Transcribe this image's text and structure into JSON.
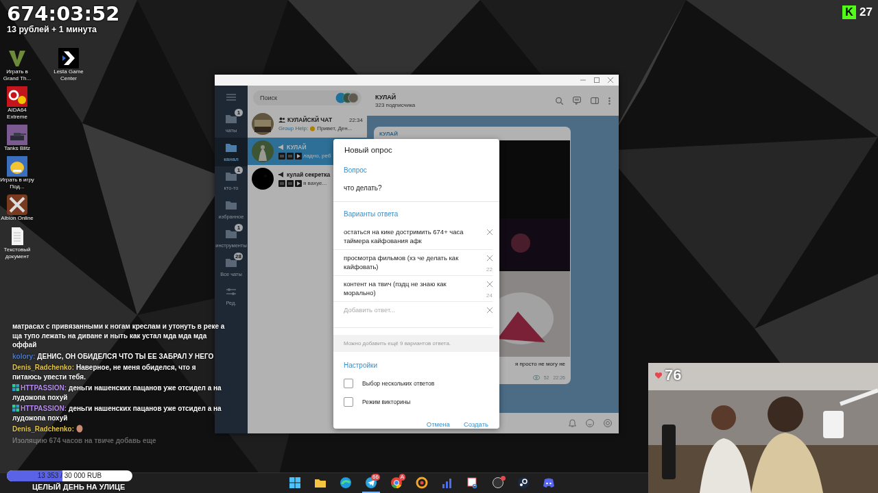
{
  "stream_overlay": {
    "timer": "674:03:52",
    "timer_note": "13 рублей + 1 минута",
    "viewer_badge": {
      "logo": "K",
      "count": "27"
    },
    "likes": "76",
    "goal": {
      "reading": "13 353 / 30 000 RUB",
      "level": 0.445,
      "title": "ЦЕЛЫЙ ДЕНЬ НА УЛИЦЕ"
    }
  },
  "desktop_icons": [
    {
      "kind": "gta",
      "label": "Играть в Grand Th..."
    },
    {
      "kind": "lesta",
      "label": "Lesta Game Center"
    },
    {
      "kind": "aida",
      "label": "AIDA64 Extreme"
    },
    {
      "kind": "tanks",
      "label": "Tanks Blitz"
    },
    {
      "kind": "fish",
      "label": "Играть в игру Под..."
    },
    {
      "kind": "albion",
      "label": "Albion Online"
    },
    {
      "kind": "document",
      "label": "Текстовый документ"
    }
  ],
  "chat_overlay": [
    {
      "kind": "text",
      "badge": false,
      "text": "матрасах с привязанными к ногам креслам и утонуть в реке а ща тупо лежать на диване и ныть как устал мда мда мда оффай"
    },
    {
      "kind": "text",
      "badge": false,
      "user": "kolory:",
      "color": "#4a7fd6",
      "text": "ДЕНИС, ОН ОБИДЕЛСЯ ЧТО ТЫ ЕЕ ЗАБРАЛ У НЕГО"
    },
    {
      "kind": "text",
      "badge": false,
      "user": "Denis_Radchenko:",
      "color": "#e2c54c",
      "text": "Наверное, не меня обиделся, что я питаюсь увести тебя."
    },
    {
      "kind": "text",
      "badge": true,
      "user": "HTTPASSION:",
      "color": "#b98cf2",
      "text": "деньги нашенских пацанов уже отсидел а на лудожопа похуй"
    },
    {
      "kind": "text",
      "badge": true,
      "user": "HTTPASSION:",
      "color": "#b98cf2",
      "text": "деньги нашенских пацанов уже отсидел а на лудожопа похуй"
    },
    {
      "kind": "emoji",
      "badge": false,
      "user": "Denis_Radchenko:",
      "color": "#e2c54c"
    },
    {
      "kind": "faded",
      "badge": false,
      "text": "Изоляцию 674 часов на твиче добавь еще"
    }
  ],
  "telegram": {
    "folders": [
      {
        "label": "чаты",
        "badge": "1",
        "selected": false
      },
      {
        "label": "канал",
        "selected": true
      },
      {
        "label": "кто-то",
        "badge": "1",
        "selected": false
      },
      {
        "label": "избранное",
        "selected": false
      },
      {
        "label": "инструменты",
        "badge": "1",
        "selected": false
      },
      {
        "label": "Все чаты",
        "badge": "28",
        "selected": false
      },
      {
        "label": "Ред.",
        "selected": false,
        "kind": "edit"
      }
    ],
    "search": {
      "placeholder": "Поиск"
    },
    "chats": [
      {
        "kind": "group",
        "title": "КУЛАЙСКЙ ЧАТ",
        "time": "22:34",
        "sender": "Group Help:",
        "preview": "Привет, Ден...",
        "selected": false,
        "media": false
      },
      {
        "kind": "channel",
        "title": "КУЛАЙ",
        "preview": "ладно, реб",
        "selected": true,
        "media": true
      },
      {
        "kind": "channel",
        "title": "кулай секретка",
        "preview": "я вахуе...",
        "selected": false,
        "media": true
      }
    ],
    "channel": {
      "title": "КУЛАЙ",
      "subtitle": "323 подписчика",
      "post": {
        "author": "КУЛАЙ",
        "caption": "я просто не могу не",
        "views": "52",
        "time": "22:26"
      }
    },
    "poll": {
      "title": "Новый опрос",
      "question_label": "Вопрос",
      "question": "что делать?",
      "options_label": "Варианты ответа",
      "options": [
        {
          "text": "остаться на кике достримить 674+ часа таймера кайфования афк"
        },
        {
          "text": "просмотра фильмов (хз че делать как кайфовать)",
          "counter": "22"
        },
        {
          "text": "контент на твич (пздц не знаю как морально)",
          "counter": "24"
        }
      ],
      "add_placeholder": "Добавить ответ...",
      "hint": "Можно добавить ещё 9 вариантов ответа.",
      "settings_label": "Настройки",
      "settings": [
        {
          "label": "Выбор нескольких ответов",
          "checked": false
        },
        {
          "label": "Режим викторины",
          "checked": false
        }
      ],
      "buttons": [
        "Отмена",
        "Создать"
      ]
    }
  },
  "taskbar": {
    "apps": [
      {
        "kind": "windows"
      },
      {
        "kind": "folder"
      },
      {
        "kind": "edge"
      },
      {
        "kind": "telegram",
        "badge": "66",
        "selected": true
      },
      {
        "kind": "chrome",
        "badge": "A"
      },
      {
        "kind": "yandex"
      },
      {
        "kind": "bars"
      },
      {
        "kind": "snip"
      },
      {
        "kind": "obs",
        "alert": true
      },
      {
        "kind": "steam"
      },
      {
        "kind": "discord"
      }
    ]
  }
}
